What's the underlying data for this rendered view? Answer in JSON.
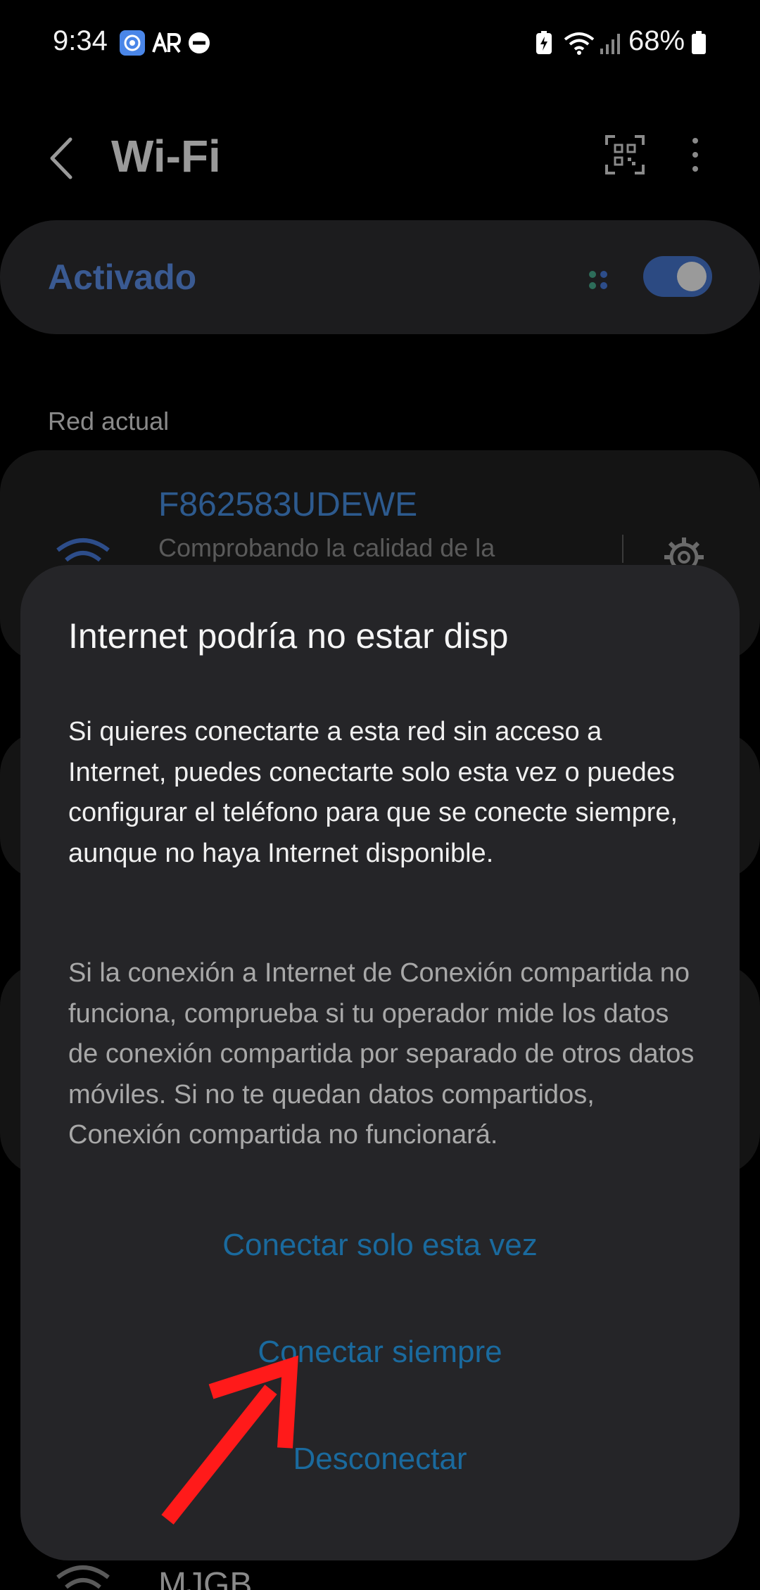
{
  "status_bar": {
    "time": "9:34",
    "battery": "68%",
    "icons": [
      "app-notification-icon",
      "ar-icon",
      "do-not-disturb-icon",
      "battery-saver-icon",
      "wifi-signal-icon",
      "cell-signal-icon",
      "battery-icon"
    ]
  },
  "header": {
    "title": "Wi-Fi",
    "back_icon": "chevron-left-icon",
    "qr_icon": "qr-scan-icon",
    "more_icon": "more-vertical-icon"
  },
  "wifi_toggle": {
    "label": "Activado",
    "on": true
  },
  "current_network": {
    "section_label": "Red actual",
    "name": "F862583UDEWE",
    "status": "Comprobando la calidad de la"
  },
  "other_network": {
    "name": "MJGB"
  },
  "dialog": {
    "title": "Internet podría no estar disp",
    "body_1": "Si quieres conectarte a esta red sin acceso a Internet, puedes conectarte solo esta vez o puedes configurar el teléfono para que se conecte siempre, aunque no haya Internet disponible.",
    "body_2": "Si la conexión a Internet de Conexión compartida no funciona, comprueba si tu operador mide los datos de conexión compartida por separado de otros datos móviles. Si no te quedan datos compartidos, Conexión compartida no funcionará.",
    "button_once": "Conectar solo esta vez",
    "button_always": "Conectar siempre",
    "button_disconnect": "Desconectar"
  },
  "colors": {
    "background": "#000000",
    "dialog": "#252528",
    "accent": "#1a6a9e",
    "arrow": "#ff1a1a"
  }
}
